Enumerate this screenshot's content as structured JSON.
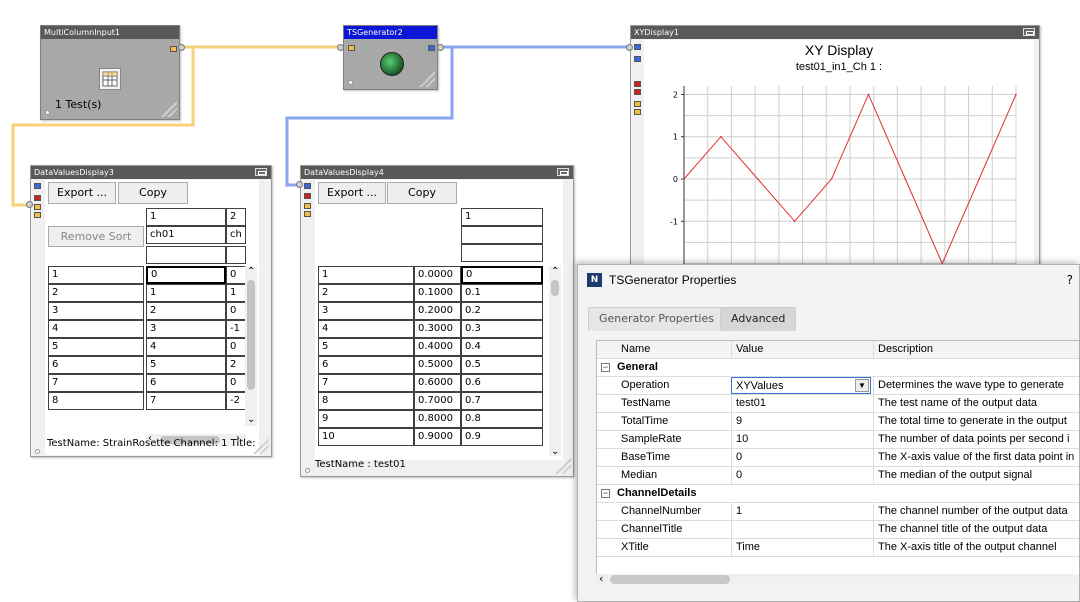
{
  "nodes": {
    "multi_column_input": {
      "title": "MultiColumnInput1",
      "caption": "1 Test(s)"
    },
    "ts_generator": {
      "title": "TSGenerator2"
    },
    "xy_display": {
      "title": "XYDisplay1",
      "chart_title": "XY Display",
      "series_label": "test01_in1_Ch 1 :"
    },
    "data_values_display3": {
      "title": "DataValuesDisplay3",
      "export_label": "Export ...",
      "copy_label": "Copy",
      "remove_sort_label": "Remove Sort",
      "col_headers": [
        "1",
        "2"
      ],
      "col_names": [
        "ch01",
        "ch"
      ],
      "rows": [
        [
          "1",
          "0",
          "0"
        ],
        [
          "2",
          "1",
          "1"
        ],
        [
          "3",
          "2",
          "0"
        ],
        [
          "4",
          "3",
          "-1"
        ],
        [
          "5",
          "4",
          "0"
        ],
        [
          "6",
          "5",
          "2"
        ],
        [
          "7",
          "6",
          "0"
        ],
        [
          "8",
          "7",
          "-2"
        ]
      ],
      "status": "TestName: StrainRosette  Channel: 1  Title:"
    },
    "data_values_display4": {
      "title": "DataValuesDisplay4",
      "export_label": "Export ...",
      "copy_label": "Copy",
      "col_header": "1",
      "rows": [
        [
          "1",
          "0.0000",
          "0"
        ],
        [
          "2",
          "0.1000",
          "0.1"
        ],
        [
          "3",
          "0.2000",
          "0.2"
        ],
        [
          "4",
          "0.3000",
          "0.3"
        ],
        [
          "5",
          "0.4000",
          "0.4"
        ],
        [
          "6",
          "0.5000",
          "0.5"
        ],
        [
          "7",
          "0.6000",
          "0.6"
        ],
        [
          "8",
          "0.7000",
          "0.7"
        ],
        [
          "9",
          "0.8000",
          "0.8"
        ],
        [
          "10",
          "0.9000",
          "0.9"
        ]
      ],
      "status": "TestName : test01"
    }
  },
  "chart_data": {
    "type": "line",
    "title": "XY Display",
    "subtitle": "test01_in1_Ch 1 :",
    "y_ticks": [
      "2",
      "1",
      "0",
      "-1"
    ],
    "x": [
      0,
      1,
      2,
      3,
      4,
      5,
      6,
      7,
      8,
      9
    ],
    "series": [
      {
        "name": "test01_in1_Ch 1",
        "color": "#e03030",
        "values": [
          0,
          1,
          0,
          -1,
          0,
          2,
          0,
          -2,
          0,
          2
        ]
      }
    ],
    "ylim": [
      -2.2,
      2.2
    ],
    "grid": true
  },
  "dialog": {
    "title": "TSGenerator Properties",
    "help": "?",
    "tabs": [
      "Generator Properties",
      "Advanced"
    ],
    "active_tab": "Advanced",
    "columns": {
      "name": "Name",
      "value": "Value",
      "description": "Description"
    },
    "categories": [
      {
        "label": "General",
        "props": [
          {
            "name": "Operation",
            "value": "XYValues",
            "desc": "Determines the wave type to generate"
          },
          {
            "name": "TestName",
            "value": "test01",
            "desc": "The test name of the output data"
          },
          {
            "name": "TotalTime",
            "value": "9",
            "desc": "The total time to generate in the output"
          },
          {
            "name": "SampleRate",
            "value": "10",
            "desc": "The number of data points per second i"
          },
          {
            "name": "BaseTime",
            "value": "0",
            "desc": "The X-axis value of the first data point in"
          },
          {
            "name": "Median",
            "value": "0",
            "desc": "The median of the output signal"
          }
        ]
      },
      {
        "label": "ChannelDetails",
        "props": [
          {
            "name": "ChannelNumber",
            "value": "1",
            "desc": "The channel number of the output data"
          },
          {
            "name": "ChannelTitle",
            "value": "",
            "desc": "The channel title of the output data"
          },
          {
            "name": "XTitle",
            "value": "Time",
            "desc": "The X-axis title of the output channel"
          }
        ]
      }
    ]
  }
}
